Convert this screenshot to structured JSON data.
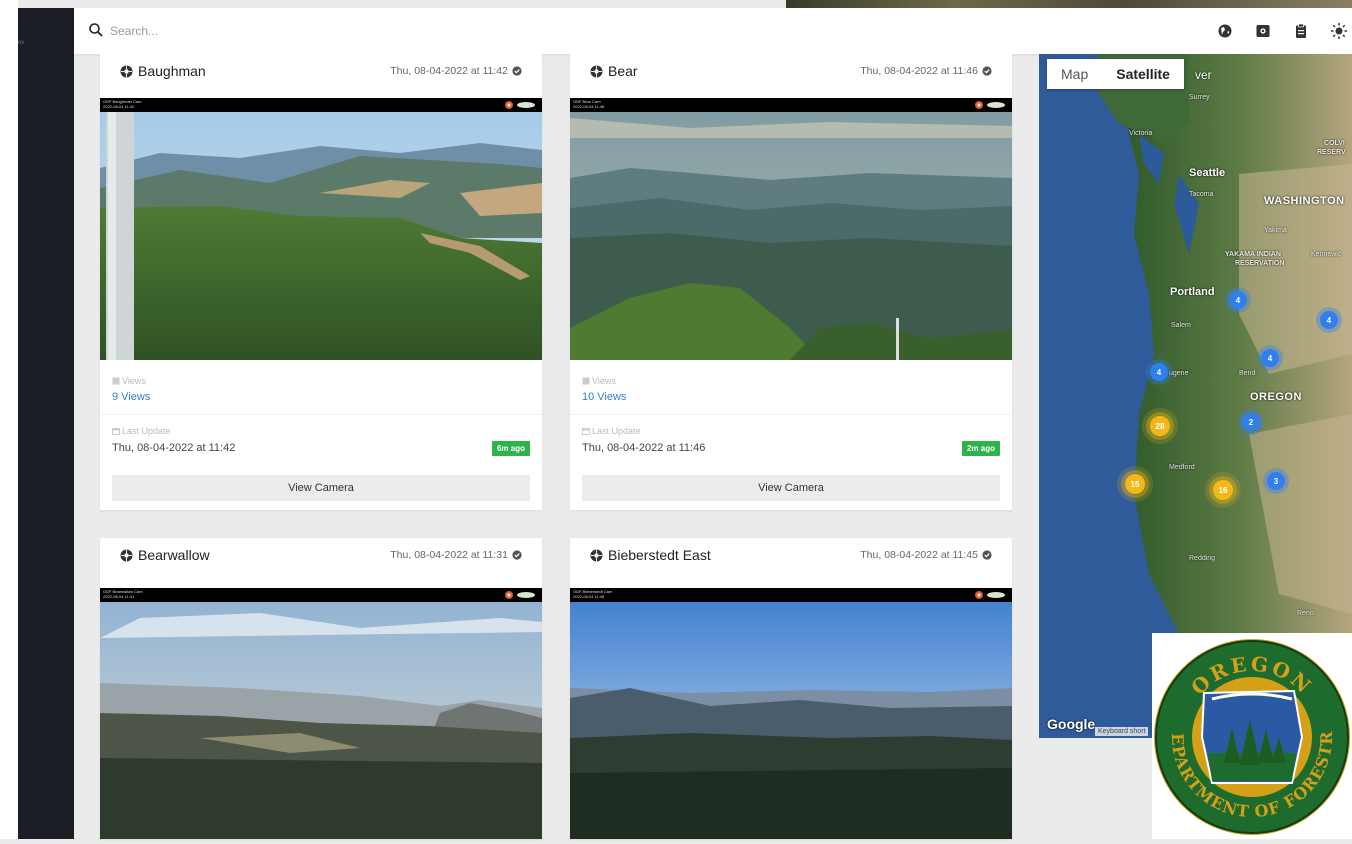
{
  "sidebar": {
    "mini_text": "ov"
  },
  "search": {
    "placeholder": "Search..."
  },
  "toolbar": {
    "icons": [
      "globe-icon",
      "camera-square-icon",
      "clipboard-icon",
      "brightness-icon"
    ]
  },
  "cards": [
    {
      "title": "Baughman",
      "date": "Thu, 08-04-2022 at 11:42",
      "views_label": "Views",
      "views": "9 Views",
      "last_update_label": "Last Update",
      "last_update": "Thu, 08-04-2022 at 11:42",
      "badge": "6m ago",
      "button": "View Camera"
    },
    {
      "title": "Bear",
      "date": "Thu, 08-04-2022 at 11:46",
      "views_label": "Views",
      "views": "10 Views",
      "last_update_label": "Last Update",
      "last_update": "Thu, 08-04-2022 at 11:46",
      "badge": "2m ago",
      "button": "View Camera"
    },
    {
      "title": "Bearwallow",
      "date": "Thu, 08-04-2022 at 11:31"
    },
    {
      "title": "Bieberstedt East",
      "date": "Thu, 08-04-2022 at 11:45"
    }
  ],
  "map": {
    "tabs": [
      "Map",
      "Satellite"
    ],
    "active_tab": "Satellite",
    "labels": {
      "surrey": "Surrey",
      "victoria": "Victoria",
      "seattle": "Seattle",
      "tacoma": "Tacoma",
      "washington": "WASHINGTON",
      "colville": "COLVI",
      "reserv": "RESERV",
      "yakima": "Yakima",
      "yakama1": "YAKAMA INDIAN",
      "yakama2": "RESERVATION",
      "kennewick": "Kennewic",
      "portland": "Portland",
      "salem": "Salem",
      "eugene": "ugene",
      "bend": "Bend",
      "oregon": "OREGON",
      "medford": "Medford",
      "redding": "Redding",
      "reno": "Reno",
      "ver": "ver"
    },
    "clusters": [
      {
        "count": "4",
        "color": "blue"
      },
      {
        "count": "4",
        "color": "blue"
      },
      {
        "count": "4",
        "color": "blue"
      },
      {
        "count": "4",
        "color": "blue"
      },
      {
        "count": "2",
        "color": "blue"
      },
      {
        "count": "3",
        "color": "blue"
      },
      {
        "count": "28",
        "color": "yellow"
      },
      {
        "count": "15",
        "color": "yellow"
      },
      {
        "count": "16",
        "color": "yellow"
      }
    ],
    "google": "Google",
    "keyboard": "Keyboard short"
  },
  "seal": {
    "top_text": "OREGON",
    "ring_text": "DEPARTMENT OF FORESTRY"
  }
}
